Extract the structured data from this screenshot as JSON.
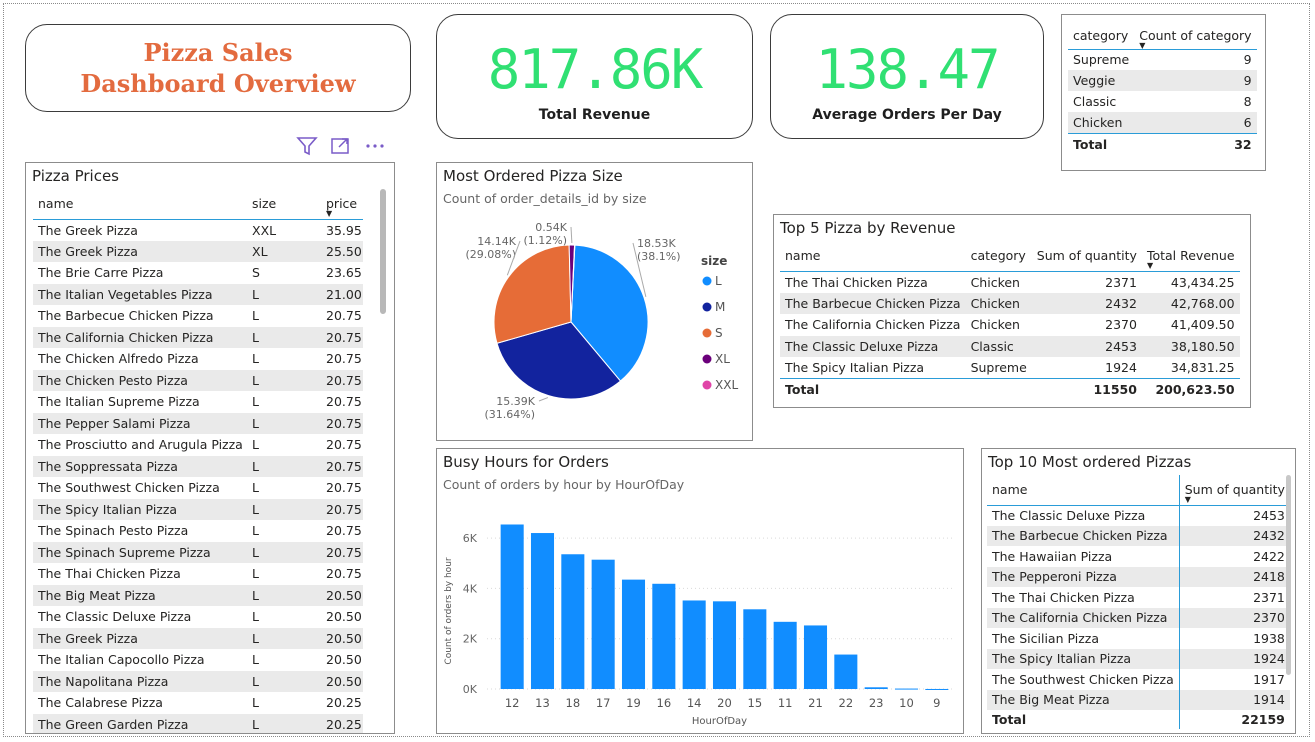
{
  "dashboard": {
    "title": "Pizza Sales Dashboard Overview",
    "colors": {
      "kpi": "#30e073",
      "title": "#e36b3f",
      "bar": "#118dff"
    }
  },
  "kpis": [
    {
      "value": "817.86K",
      "label": "Total Revenue"
    },
    {
      "value": "138.47",
      "label": "Average Orders Per Day"
    }
  ],
  "category_table": {
    "headers": [
      "category",
      "Count of category"
    ],
    "rows": [
      [
        "Supreme",
        "9"
      ],
      [
        "Veggie",
        "9"
      ],
      [
        "Classic",
        "8"
      ],
      [
        "Chicken",
        "6"
      ]
    ],
    "total": [
      "Total",
      "32"
    ]
  },
  "toolbar": {
    "icons": [
      "filter-icon",
      "focus-mode-icon",
      "more-options-icon"
    ]
  },
  "pizza_prices": {
    "title": "Pizza Prices",
    "headers": [
      "name",
      "size",
      "price"
    ],
    "rows": [
      [
        "The Greek Pizza",
        "XXL",
        "35.95"
      ],
      [
        "The Greek Pizza",
        "XL",
        "25.50"
      ],
      [
        "The Brie Carre Pizza",
        "S",
        "23.65"
      ],
      [
        "The Italian Vegetables Pizza",
        "L",
        "21.00"
      ],
      [
        "The Barbecue Chicken Pizza",
        "L",
        "20.75"
      ],
      [
        "The California Chicken Pizza",
        "L",
        "20.75"
      ],
      [
        "The Chicken Alfredo Pizza",
        "L",
        "20.75"
      ],
      [
        "The Chicken Pesto Pizza",
        "L",
        "20.75"
      ],
      [
        "The Italian Supreme Pizza",
        "L",
        "20.75"
      ],
      [
        "The Pepper Salami Pizza",
        "L",
        "20.75"
      ],
      [
        "The Prosciutto and Arugula Pizza",
        "L",
        "20.75"
      ],
      [
        "The Soppressata Pizza",
        "L",
        "20.75"
      ],
      [
        "The Southwest Chicken Pizza",
        "L",
        "20.75"
      ],
      [
        "The Spicy Italian Pizza",
        "L",
        "20.75"
      ],
      [
        "The Spinach Pesto Pizza",
        "L",
        "20.75"
      ],
      [
        "The Spinach Supreme Pizza",
        "L",
        "20.75"
      ],
      [
        "The Thai Chicken Pizza",
        "L",
        "20.75"
      ],
      [
        "The Big Meat Pizza",
        "L",
        "20.50"
      ],
      [
        "The Classic Deluxe Pizza",
        "L",
        "20.50"
      ],
      [
        "The Greek Pizza",
        "L",
        "20.50"
      ],
      [
        "The Italian Capocollo Pizza",
        "L",
        "20.50"
      ],
      [
        "The Napolitana Pizza",
        "L",
        "20.50"
      ],
      [
        "The Calabrese Pizza",
        "L",
        "20.25"
      ],
      [
        "The Green Garden Pizza",
        "L",
        "20.25"
      ]
    ]
  },
  "pie": {
    "title": "Most Ordered Pizza Size",
    "subtitle": "Count of order_details_id by size",
    "legend_title": "size",
    "slices": [
      {
        "name": "L",
        "value": 18526,
        "color": "#118dff",
        "label": "18.53K",
        "pct": "(38.1%)"
      },
      {
        "name": "M",
        "value": 15385,
        "color": "#12239e",
        "label": "15.39K",
        "pct": "(31.64%)"
      },
      {
        "name": "S",
        "value": 14137,
        "color": "#e66c37",
        "label": "14.14K",
        "pct": "(29.08%)"
      },
      {
        "name": "XL",
        "value": 544,
        "color": "#6b007b",
        "label": "0.54K",
        "pct": "(1.12%)"
      },
      {
        "name": "XXL",
        "value": 28,
        "color": "#e044a7",
        "label": "",
        "pct": ""
      }
    ]
  },
  "top5": {
    "title": "Top 5 Pizza by Revenue",
    "headers": [
      "name",
      "category",
      "Sum of quantity",
      "Total Revenue"
    ],
    "rows": [
      [
        "The Thai Chicken Pizza",
        "Chicken",
        "2371",
        "43,434.25"
      ],
      [
        "The Barbecue Chicken Pizza",
        "Chicken",
        "2432",
        "42,768.00"
      ],
      [
        "The California Chicken Pizza",
        "Chicken",
        "2370",
        "41,409.50"
      ],
      [
        "The Classic Deluxe Pizza",
        "Classic",
        "2453",
        "38,180.50"
      ],
      [
        "The Spicy Italian Pizza",
        "Supreme",
        "1924",
        "34,831.25"
      ]
    ],
    "total": [
      "Total",
      "",
      "11550",
      "200,623.50"
    ]
  },
  "chart_data": {
    "type": "bar",
    "title": "Busy Hours for Orders",
    "subtitle": "Count of orders by hour by HourOfDay",
    "xlabel": "HourOfDay",
    "ylabel": "Count of orders by hour",
    "categories": [
      "12",
      "13",
      "18",
      "17",
      "19",
      "16",
      "14",
      "20",
      "15",
      "11",
      "21",
      "22",
      "23",
      "10",
      "9"
    ],
    "values": [
      6543,
      6203,
      5359,
      5143,
      4350,
      4185,
      3521,
      3487,
      3170,
      2672,
      2528,
      1370,
      68,
      17,
      1
    ],
    "ylim": [
      0,
      7000
    ],
    "yticks": [
      "0K",
      "2K",
      "4K",
      "6K"
    ],
    "ytick_values": [
      0,
      2000,
      4000,
      6000
    ],
    "grid": true
  },
  "top10": {
    "title": "Top 10 Most ordered Pizzas",
    "headers": [
      "name",
      "Sum of quantity"
    ],
    "rows": [
      [
        "The Classic Deluxe Pizza",
        "2453"
      ],
      [
        "The Barbecue Chicken Pizza",
        "2432"
      ],
      [
        "The Hawaiian Pizza",
        "2422"
      ],
      [
        "The Pepperoni Pizza",
        "2418"
      ],
      [
        "The Thai Chicken Pizza",
        "2371"
      ],
      [
        "The California Chicken Pizza",
        "2370"
      ],
      [
        "The Sicilian Pizza",
        "1938"
      ],
      [
        "The Spicy Italian Pizza",
        "1924"
      ],
      [
        "The Southwest Chicken Pizza",
        "1917"
      ],
      [
        "The Big Meat Pizza",
        "1914"
      ]
    ],
    "total": [
      "Total",
      "22159"
    ]
  }
}
